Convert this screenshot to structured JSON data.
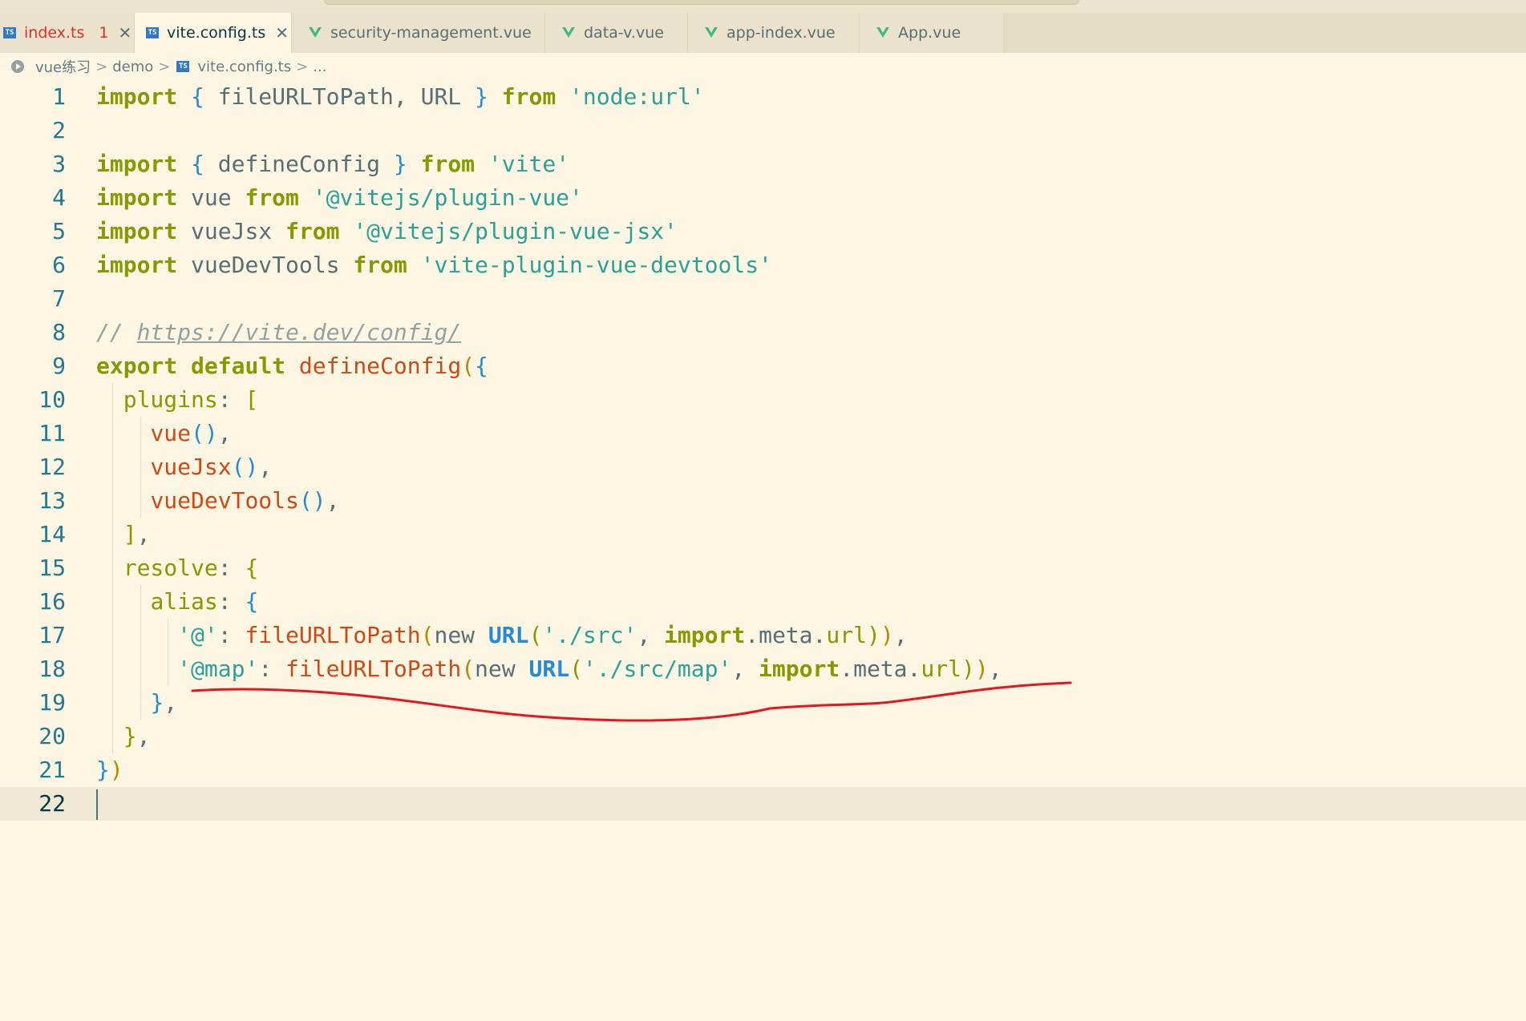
{
  "tabs": [
    {
      "label": "index.ts",
      "icon": "ts-icon",
      "badge": "1",
      "close": "✕",
      "error": true
    },
    {
      "label": "vite.config.ts",
      "icon": "ts-icon",
      "close": "✕",
      "active": true
    },
    {
      "label": "security-management.vue",
      "icon": "vue-icon"
    },
    {
      "label": "data-v.vue",
      "icon": "vue-icon"
    },
    {
      "label": "app-index.vue",
      "icon": "vue-icon"
    },
    {
      "label": "App.vue",
      "icon": "vue-icon"
    }
  ],
  "breadcrumb": {
    "items": [
      "vue练习",
      "demo",
      "vite.config.ts",
      "..."
    ],
    "separator": ">"
  },
  "editor": {
    "current_line": 22,
    "lines": [
      {
        "n": "1",
        "tokens": [
          [
            "kw2",
            "import"
          ],
          [
            "p",
            " "
          ],
          [
            "b2",
            "{"
          ],
          [
            "p",
            " fileURLToPath, URL "
          ],
          [
            "b2",
            "}"
          ],
          [
            "p",
            " "
          ],
          [
            "kw2",
            "from"
          ],
          [
            "p",
            " "
          ],
          [
            "str",
            "'node:url'"
          ]
        ]
      },
      {
        "n": "2",
        "tokens": []
      },
      {
        "n": "3",
        "tokens": [
          [
            "kw2",
            "import"
          ],
          [
            "p",
            " "
          ],
          [
            "b2",
            "{"
          ],
          [
            "p",
            " defineConfig "
          ],
          [
            "b2",
            "}"
          ],
          [
            "p",
            " "
          ],
          [
            "kw2",
            "from"
          ],
          [
            "p",
            " "
          ],
          [
            "str",
            "'vite'"
          ]
        ]
      },
      {
        "n": "4",
        "tokens": [
          [
            "kw2",
            "import"
          ],
          [
            "p",
            " vue "
          ],
          [
            "kw2",
            "from"
          ],
          [
            "p",
            " "
          ],
          [
            "str",
            "'@vitejs/plugin-vue'"
          ]
        ]
      },
      {
        "n": "5",
        "tokens": [
          [
            "kw2",
            "import"
          ],
          [
            "p",
            " vueJsx "
          ],
          [
            "kw2",
            "from"
          ],
          [
            "p",
            " "
          ],
          [
            "str",
            "'@vitejs/plugin-vue-jsx'"
          ]
        ]
      },
      {
        "n": "6",
        "tokens": [
          [
            "kw2",
            "import"
          ],
          [
            "p",
            " vueDevTools "
          ],
          [
            "kw2",
            "from"
          ],
          [
            "p",
            " "
          ],
          [
            "str",
            "'vite-plugin-vue-devtools'"
          ]
        ]
      },
      {
        "n": "7",
        "tokens": []
      },
      {
        "n": "8",
        "tokens": [
          [
            "cmt",
            "// "
          ],
          [
            "cmtlink",
            "https://vite.dev/config/"
          ]
        ]
      },
      {
        "n": "9",
        "tokens": [
          [
            "kw2",
            "export"
          ],
          [
            "p",
            " "
          ],
          [
            "kw2",
            "default"
          ],
          [
            "p",
            " "
          ],
          [
            "fn",
            "defineConfig"
          ],
          [
            "b1",
            "("
          ],
          [
            "b2",
            "{"
          ]
        ]
      },
      {
        "n": "10",
        "tokens": [
          [
            "p",
            "  "
          ],
          [
            "prop",
            "plugins"
          ],
          [
            "p",
            ": "
          ],
          [
            "b3",
            "["
          ]
        ]
      },
      {
        "n": "11",
        "tokens": [
          [
            "p",
            "    "
          ],
          [
            "fn",
            "vue"
          ],
          [
            "b2",
            "()"
          ],
          [
            "p",
            ","
          ]
        ]
      },
      {
        "n": "12",
        "tokens": [
          [
            "p",
            "    "
          ],
          [
            "fn",
            "vueJsx"
          ],
          [
            "b2",
            "()"
          ],
          [
            "p",
            ","
          ]
        ]
      },
      {
        "n": "13",
        "tokens": [
          [
            "p",
            "    "
          ],
          [
            "fn",
            "vueDevTools"
          ],
          [
            "b2",
            "()"
          ],
          [
            "p",
            ","
          ]
        ]
      },
      {
        "n": "14",
        "tokens": [
          [
            "p",
            "  "
          ],
          [
            "b3",
            "]"
          ],
          [
            "p",
            ","
          ]
        ]
      },
      {
        "n": "15",
        "tokens": [
          [
            "p",
            "  "
          ],
          [
            "prop",
            "resolve"
          ],
          [
            "p",
            ": "
          ],
          [
            "b3",
            "{"
          ]
        ]
      },
      {
        "n": "16",
        "tokens": [
          [
            "p",
            "    "
          ],
          [
            "prop",
            "alias"
          ],
          [
            "p",
            ": "
          ],
          [
            "b2",
            "{"
          ]
        ]
      },
      {
        "n": "17",
        "tokens": [
          [
            "p",
            "      "
          ],
          [
            "str",
            "'@'"
          ],
          [
            "p",
            ": "
          ],
          [
            "fn",
            "fileURLToPath"
          ],
          [
            "b1",
            "("
          ],
          [
            "p",
            "new "
          ],
          [
            "cls",
            "URL"
          ],
          [
            "b3",
            "("
          ],
          [
            "str",
            "'./src'"
          ],
          [
            "p",
            ", "
          ],
          [
            "kw2",
            "import"
          ],
          [
            "p",
            ".meta."
          ],
          [
            "prop",
            "url"
          ],
          [
            "b3",
            ")"
          ],
          [
            "b1",
            ")"
          ],
          [
            "p",
            ","
          ]
        ]
      },
      {
        "n": "18",
        "tokens": [
          [
            "p",
            "      "
          ],
          [
            "str",
            "'@map'"
          ],
          [
            "p",
            ": "
          ],
          [
            "fn",
            "fileURLToPath"
          ],
          [
            "b1",
            "("
          ],
          [
            "p",
            "new "
          ],
          [
            "cls",
            "URL"
          ],
          [
            "b3",
            "("
          ],
          [
            "str",
            "'./src/map'"
          ],
          [
            "p",
            ", "
          ],
          [
            "kw2",
            "import"
          ],
          [
            "p",
            ".meta."
          ],
          [
            "prop",
            "url"
          ],
          [
            "b3",
            ")"
          ],
          [
            "b1",
            ")"
          ],
          [
            "p",
            ","
          ]
        ]
      },
      {
        "n": "19",
        "tokens": [
          [
            "p",
            "    "
          ],
          [
            "b2",
            "}"
          ],
          [
            "p",
            ","
          ]
        ]
      },
      {
        "n": "20",
        "tokens": [
          [
            "p",
            "  "
          ],
          [
            "b3",
            "}"
          ],
          [
            "p",
            ","
          ]
        ]
      },
      {
        "n": "21",
        "tokens": [
          [
            "b2",
            "}"
          ],
          [
            "b1",
            ")"
          ]
        ]
      },
      {
        "n": "22",
        "tokens": []
      }
    ]
  },
  "colors": {
    "background": "#fdf6e3",
    "annotation": "#e8151b"
  }
}
